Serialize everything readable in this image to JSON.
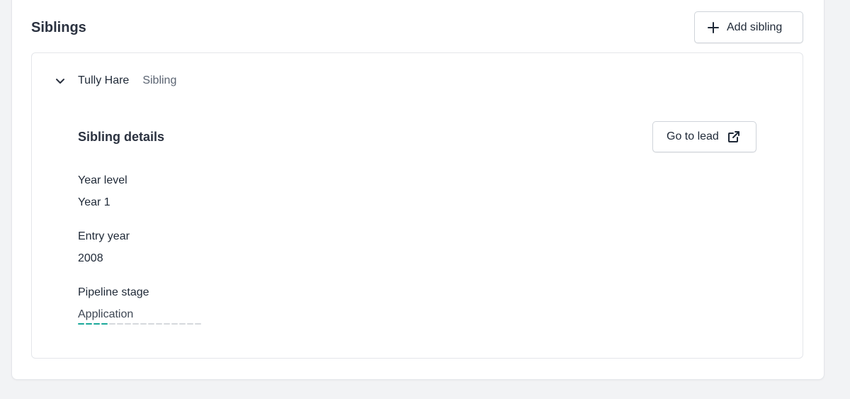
{
  "section": {
    "title": "Siblings",
    "add_label": "Add sibling"
  },
  "sibling": {
    "name": "Tully Hare",
    "relation": "Sibling",
    "details_title": "Sibling details",
    "go_to_lead_label": "Go to lead",
    "fields": [
      {
        "label": "Year level",
        "value": "Year 1"
      },
      {
        "label": "Entry year",
        "value": "2008"
      },
      {
        "label": "Pipeline stage",
        "value": "Application"
      }
    ],
    "pipeline_progress": {
      "completed_steps": 4,
      "total_steps": 16
    }
  },
  "colors": {
    "progress_done": "#1aa89a",
    "progress_todo": "#d6d9dd"
  },
  "icons": {
    "add": "plus-icon",
    "expand": "chevron-down-icon",
    "external": "external-link-icon"
  }
}
